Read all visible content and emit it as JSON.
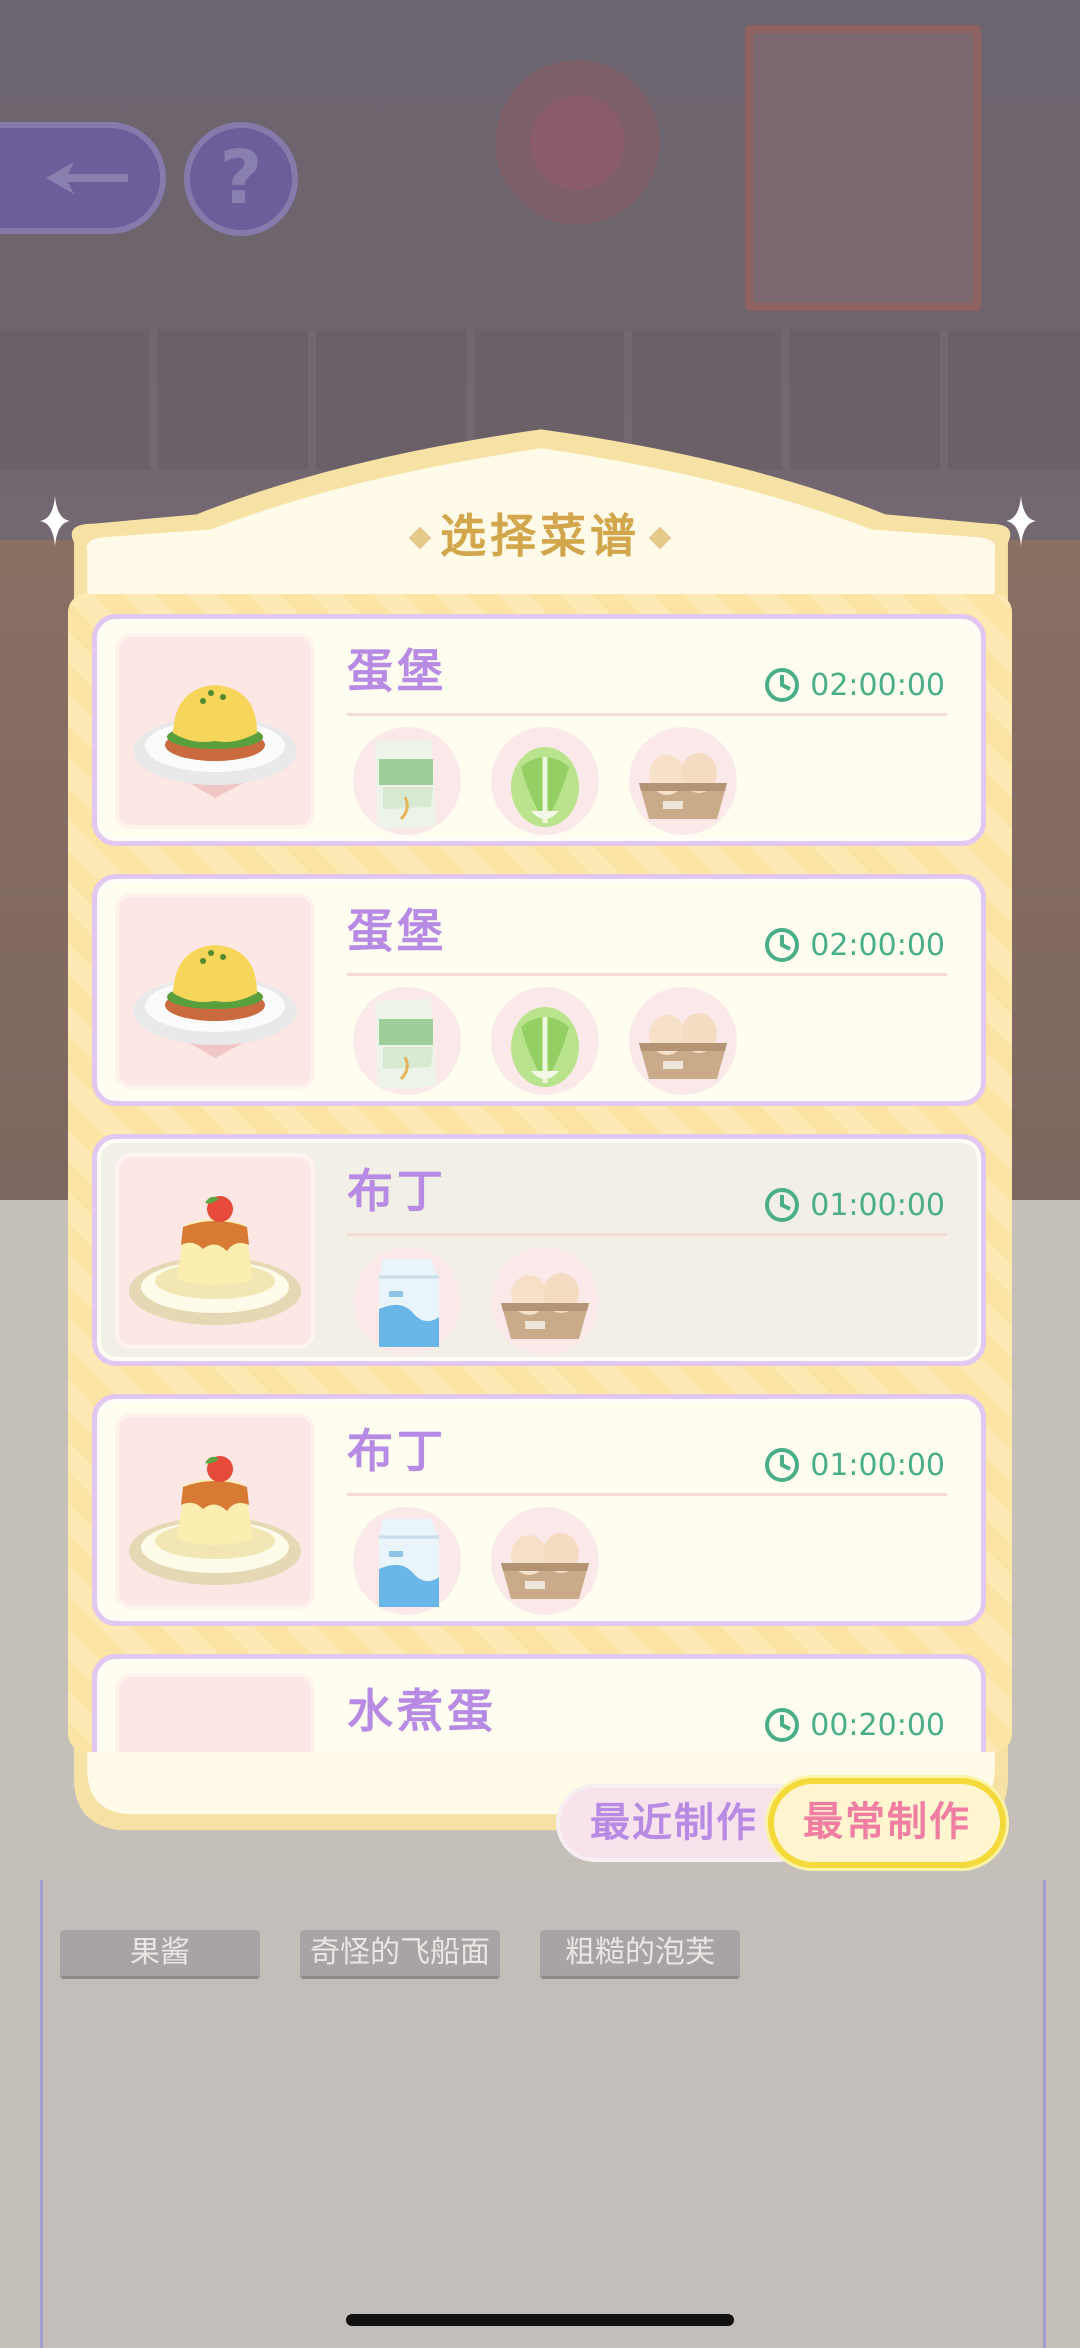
{
  "title": "选择菜谱",
  "recipes": [
    {
      "name": "蛋堡",
      "time": "02:00:00",
      "dish": "egg-burger",
      "ingredients": [
        "flour",
        "cabbage",
        "eggs"
      ],
      "selected": false
    },
    {
      "name": "蛋堡",
      "time": "02:00:00",
      "dish": "egg-burger",
      "ingredients": [
        "flour",
        "cabbage",
        "eggs"
      ],
      "selected": false
    },
    {
      "name": "布丁",
      "time": "01:00:00",
      "dish": "pudding",
      "ingredients": [
        "milk",
        "eggs"
      ],
      "selected": true
    },
    {
      "name": "布丁",
      "time": "01:00:00",
      "dish": "pudding",
      "ingredients": [
        "milk",
        "eggs"
      ],
      "selected": false
    },
    {
      "name": "水煮蛋",
      "time": "00:20:00",
      "dish": "boiled-egg",
      "ingredients": [],
      "selected": false
    }
  ],
  "buttons": {
    "recent": "最近制作",
    "common": "最常制作"
  },
  "background_labels": [
    "果酱",
    "奇怪的飞船面",
    "粗糙的泡芙"
  ],
  "colors": {
    "accent_purple": "#b78be3",
    "timer_green": "#4aaf86",
    "active_yellow": "#f3d93a"
  }
}
